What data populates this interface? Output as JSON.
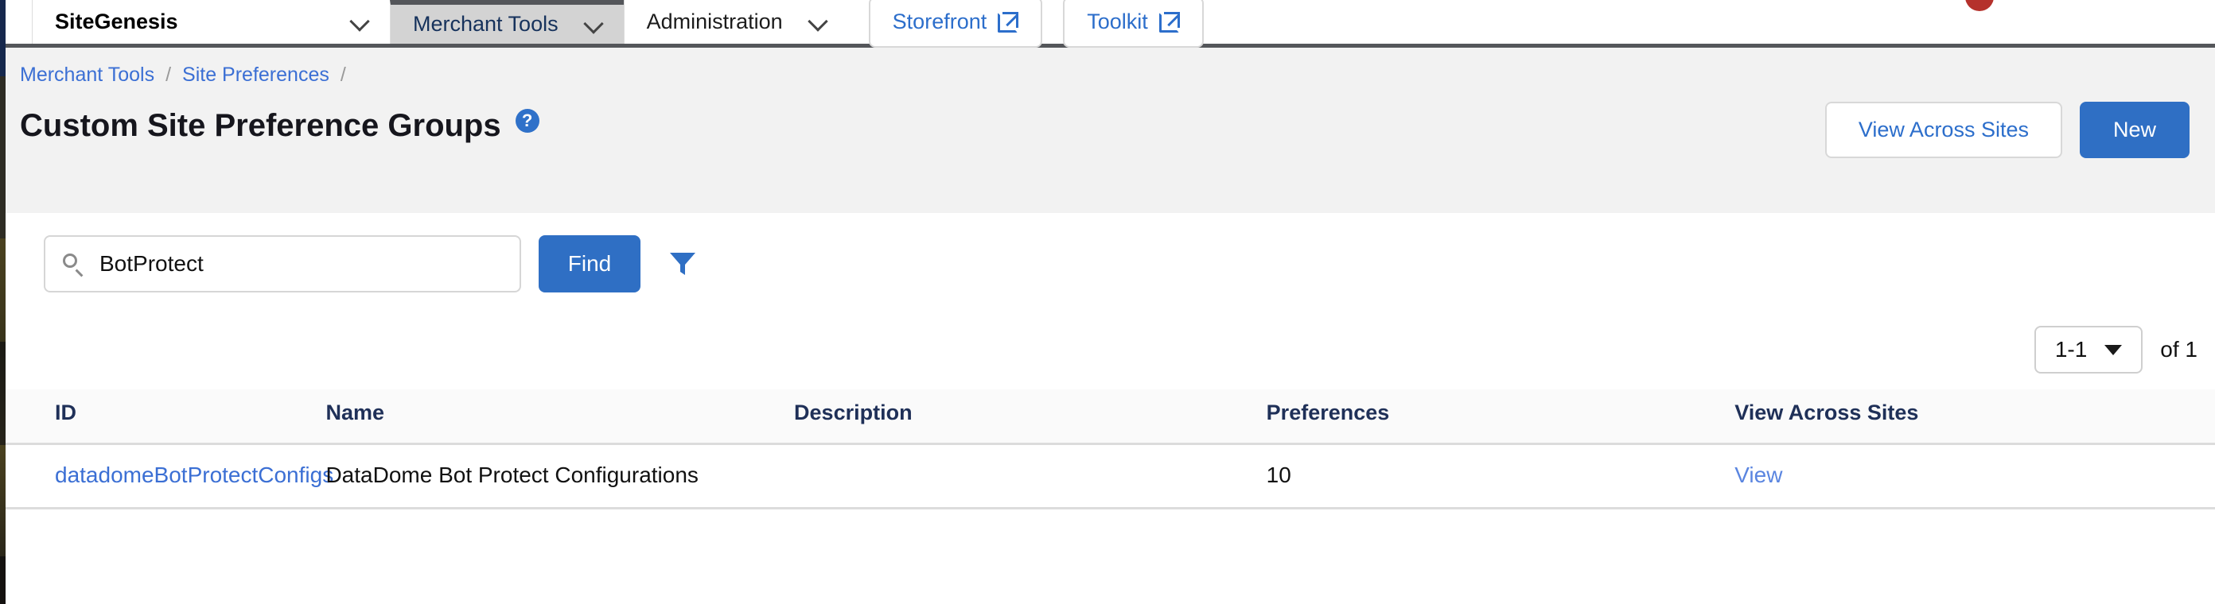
{
  "topnav": {
    "site_name": "SiteGenesis",
    "items": [
      {
        "label": "Merchant Tools",
        "active": true
      },
      {
        "label": "Administration",
        "active": false
      }
    ],
    "buttons": [
      {
        "label": "Storefront",
        "icon": "external-link-icon"
      },
      {
        "label": "Toolkit",
        "icon": "external-link-icon"
      }
    ]
  },
  "breadcrumb": {
    "items": [
      "Merchant Tools",
      "Site Preferences"
    ],
    "separator": "/"
  },
  "header": {
    "title": "Custom Site Preference Groups",
    "help_icon": "help-circle-icon",
    "view_across_sites_label": "View Across Sites",
    "new_label": "New"
  },
  "search": {
    "value": "BotProtect",
    "placeholder": "",
    "find_label": "Find",
    "search_icon": "search-icon",
    "filter_icon": "filter-funnel-icon"
  },
  "pagination": {
    "range": "1-1",
    "total_label": "of 1",
    "caret_icon": "chevron-down-icon"
  },
  "table": {
    "columns": [
      "ID",
      "Name",
      "Description",
      "Preferences",
      "View Across Sites"
    ],
    "rows": [
      {
        "id": "datadomeBotProtectConfigs",
        "name": "DataDome Bot Protect Configurations",
        "description": "",
        "preferences": "10",
        "view_across_sites": "View"
      }
    ]
  },
  "colors": {
    "accent_blue": "#2f6fc4",
    "link_blue": "#3b6fd4",
    "header_navy": "#1f3058",
    "band_gray": "#f2f2f2",
    "notification_red": "#b5312c"
  }
}
